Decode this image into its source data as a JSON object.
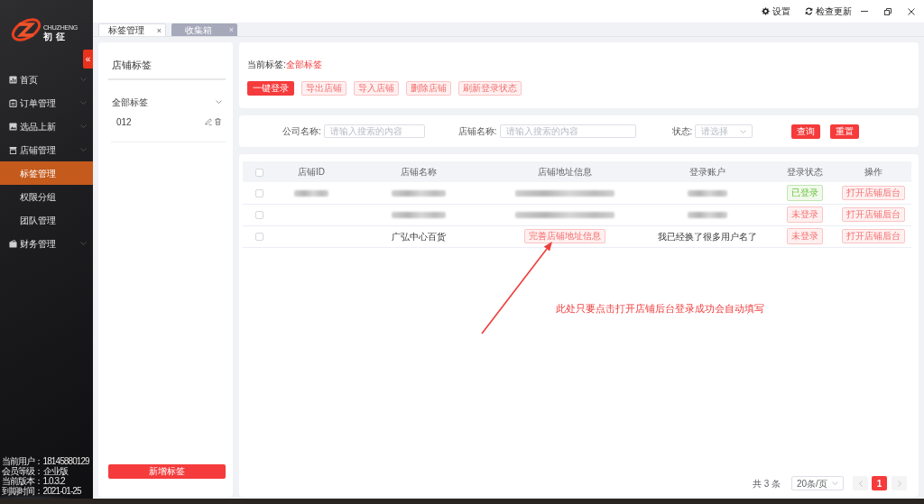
{
  "window_controls": {
    "settings": "设置",
    "check_update": "检查更新"
  },
  "sidebar": {
    "logo_latin": "CHUZHENG",
    "logo_name": "初征",
    "collapse_glyph": "«",
    "items": [
      {
        "label": "首页",
        "selected": false
      },
      {
        "label": "订单管理",
        "selected": false
      },
      {
        "label": "选品上新",
        "selected": false
      },
      {
        "label": "店铺管理",
        "selected": false,
        "expanded": true,
        "children": [
          {
            "label": "标签管理",
            "selected": true
          },
          {
            "label": "权限分组",
            "selected": false
          },
          {
            "label": "团队管理",
            "selected": false
          }
        ]
      },
      {
        "label": "财务管理",
        "selected": false
      }
    ],
    "account_info": [
      "当前用户：18145880129",
      "会员等级：企业版",
      "当前版本：1.0.3.2",
      "到期时间：2021-01-25"
    ]
  },
  "tabs": [
    {
      "label": "标签管理",
      "selected": true,
      "close": "×"
    },
    {
      "label": "收集箱",
      "selected": false,
      "close": "×"
    }
  ],
  "tag_panel": {
    "title": "店铺标签",
    "group": {
      "label": "全部标签",
      "expanded": true
    },
    "tags": [
      {
        "label": "012"
      }
    ],
    "add_button": "新增标签"
  },
  "current_tag": {
    "label": "当前标签:",
    "value": "全部标签"
  },
  "actions": [
    {
      "label": "一键登录",
      "kind": "primary"
    },
    {
      "label": "导出店铺",
      "kind": "plain"
    },
    {
      "label": "导入店铺",
      "kind": "plain"
    },
    {
      "label": "删除店铺",
      "kind": "plain"
    },
    {
      "label": "刷新登录状态",
      "kind": "plain"
    }
  ],
  "filters": [
    {
      "label": "公司名称:",
      "kind": "input",
      "placeholder": "请输入搜索的内容"
    },
    {
      "label": "店铺名称:",
      "kind": "input",
      "placeholder": "请输入搜索的内容"
    },
    {
      "label": "状态:",
      "kind": "select",
      "placeholder": "请选择"
    }
  ],
  "filter_buttons": [
    "查询",
    "重置"
  ],
  "table": {
    "header_checked": false,
    "columns": [
      "店铺ID",
      "店铺名称",
      "店铺地址信息",
      "登录账户",
      "登录状态",
      "操作"
    ],
    "rows": [
      {
        "checked": false,
        "cells": [
          {
            "kind": "blurred"
          },
          {
            "kind": "blurred"
          },
          {
            "kind": "blurred"
          },
          {
            "kind": "blurred"
          }
        ],
        "status": {
          "text": "已登录",
          "logged_in": true
        },
        "action": "打开店铺后台"
      },
      {
        "checked": false,
        "cells": [
          {
            "kind": "empty"
          },
          {
            "kind": "blurred"
          },
          {
            "kind": "blurred"
          },
          {
            "kind": "blurred"
          }
        ],
        "status": {
          "text": "未登录",
          "logged_in": false
        },
        "action": "打开店铺后台"
      },
      {
        "checked": false,
        "cells": [
          {
            "kind": "empty"
          },
          {
            "kind": "text",
            "text": "广弘中心百货"
          },
          {
            "kind": "button",
            "text": "完善店铺地址信息"
          },
          {
            "kind": "text",
            "text": "我已经换了很多用户名了"
          }
        ],
        "status": {
          "text": "未登录",
          "logged_in": false
        },
        "action": "打开店铺后台"
      }
    ]
  },
  "annotation": {
    "text": "此处只要点击打开店铺后台登录成功会自动填写"
  },
  "pagination": {
    "total": "共 3 条",
    "page_size": "20条/页",
    "pages": [
      {
        "label": "1",
        "selected": true
      }
    ]
  }
}
